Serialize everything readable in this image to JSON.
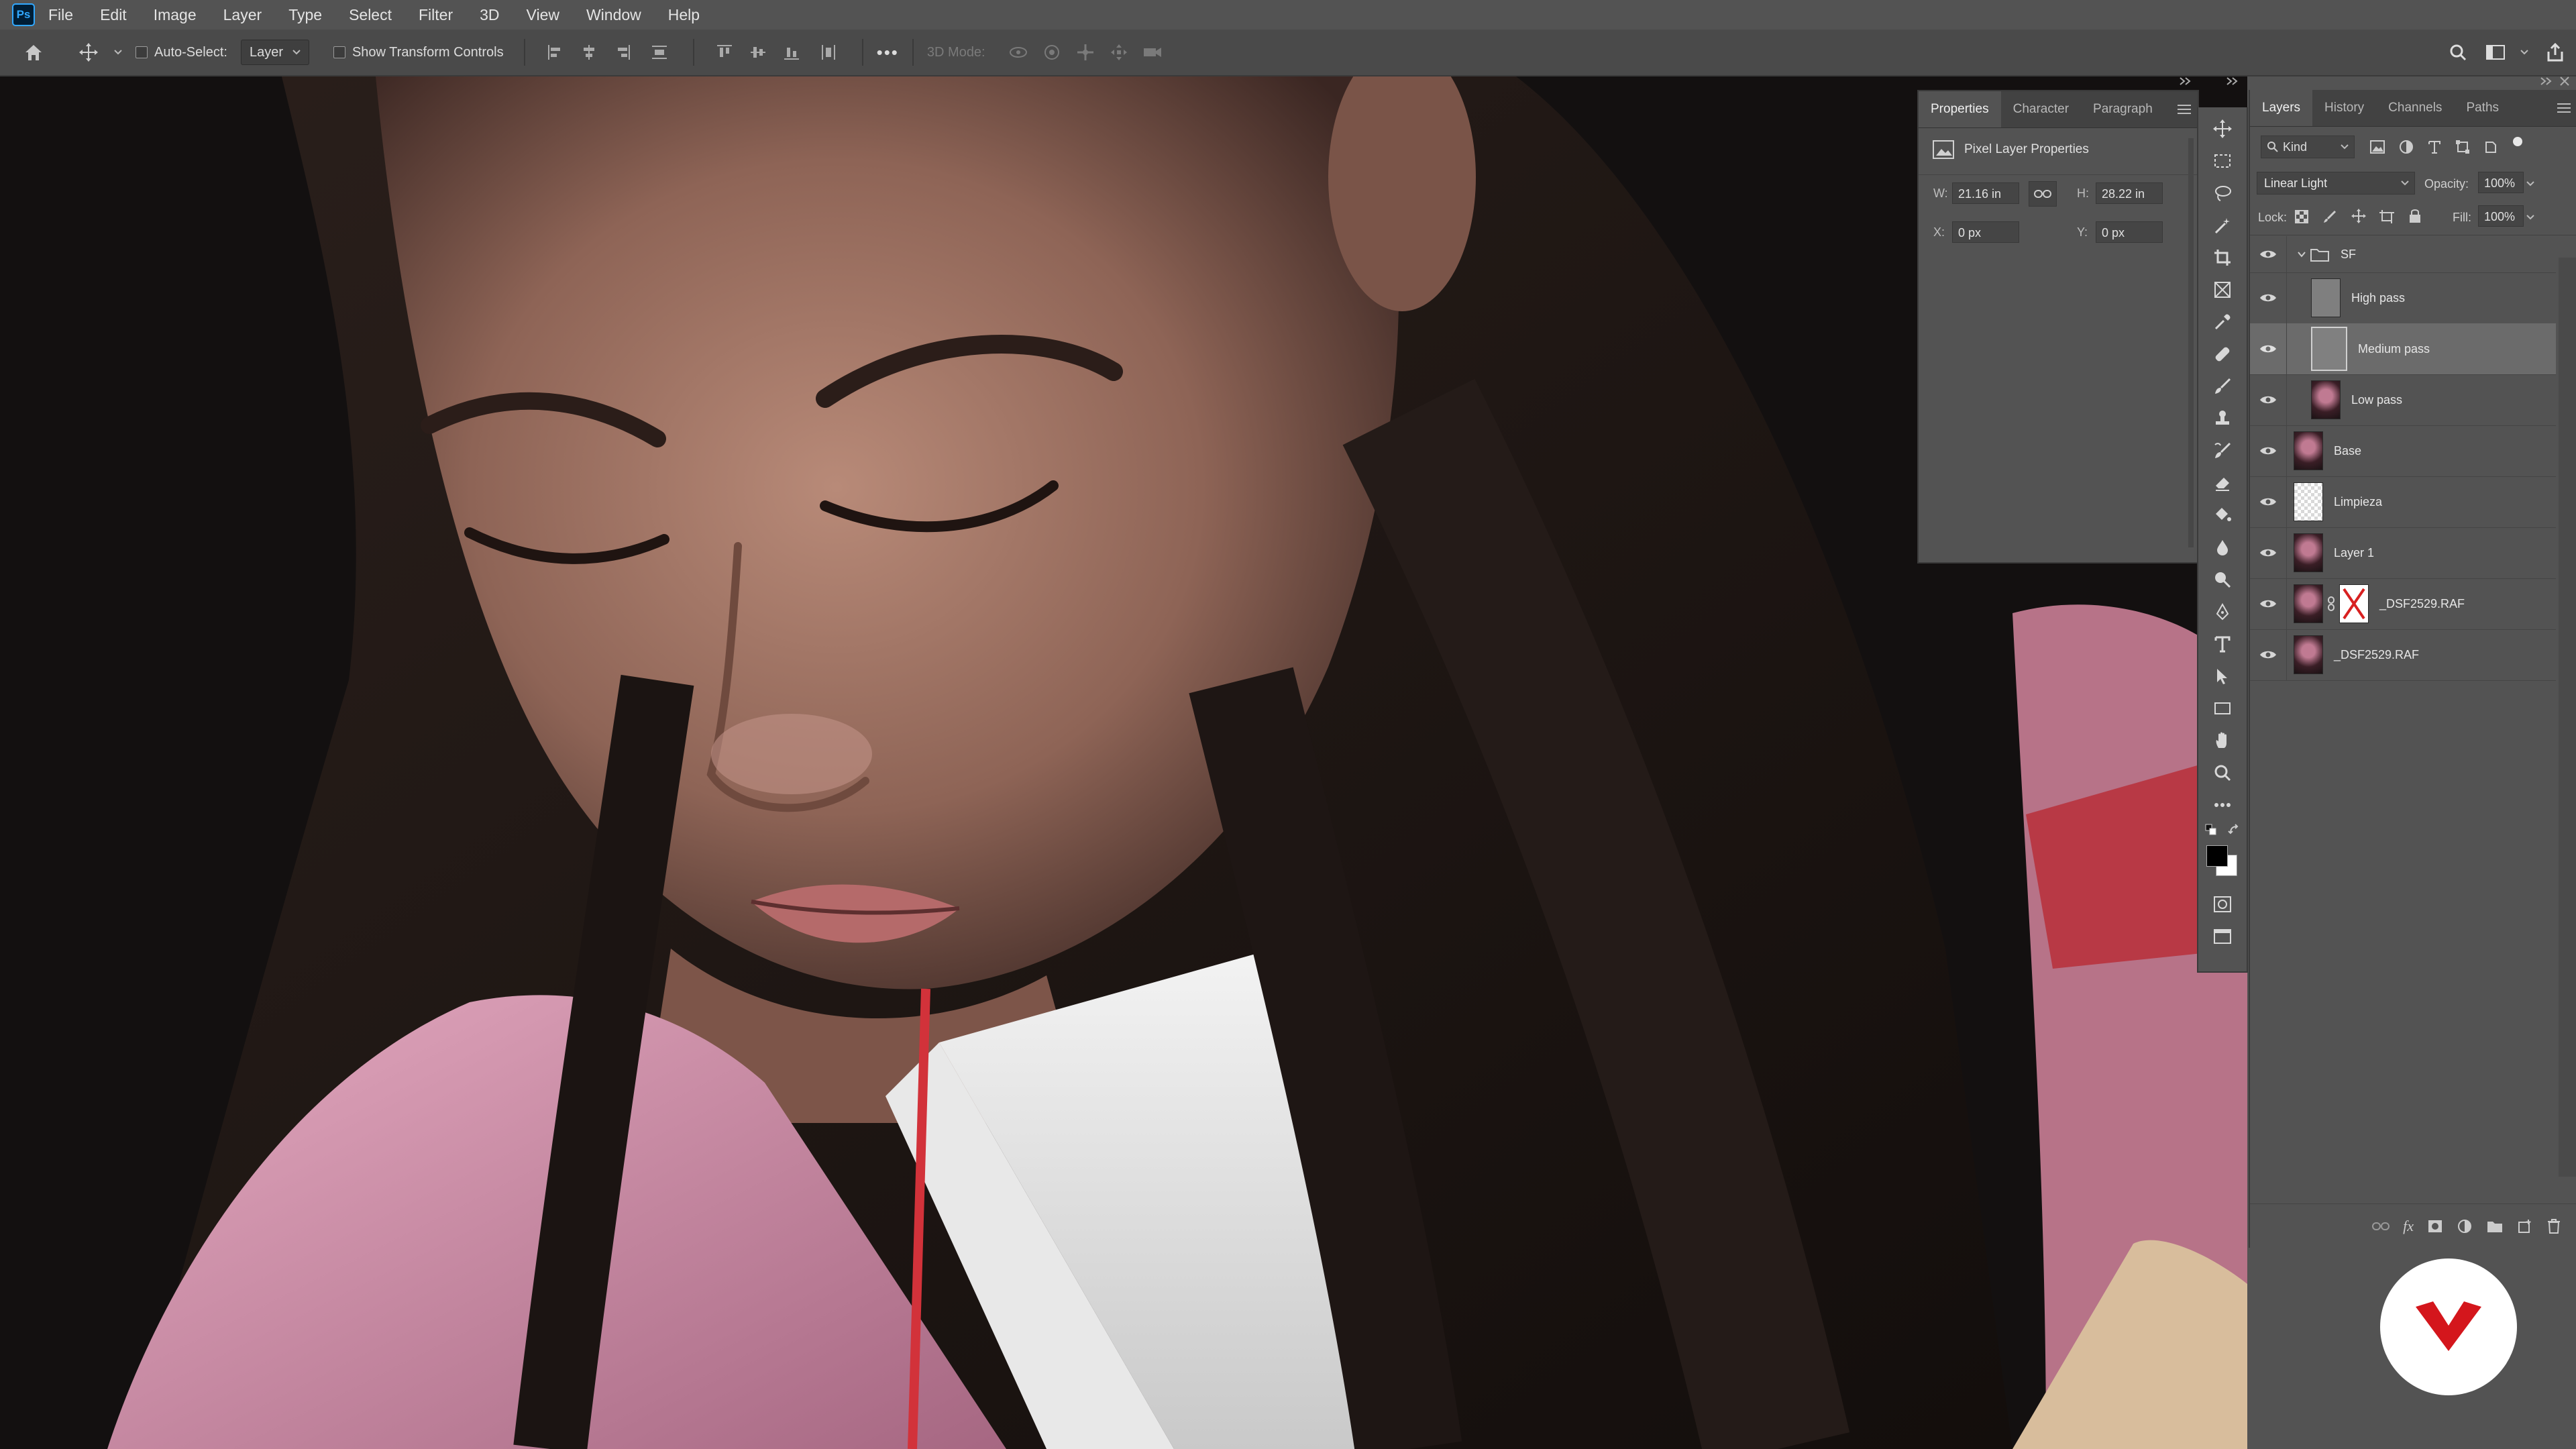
{
  "app": {
    "logo_text": "Ps"
  },
  "menubar": {
    "items": [
      "File",
      "Edit",
      "Image",
      "Layer",
      "Type",
      "Select",
      "Filter",
      "3D",
      "View",
      "Window",
      "Help"
    ]
  },
  "optionsbar": {
    "auto_select_label": "Auto-Select:",
    "auto_select_target": "Layer",
    "show_transform_label": "Show Transform Controls",
    "more_label": "•••",
    "mode_3d_label": "3D Mode:"
  },
  "properties": {
    "tabs": [
      "Properties",
      "Character",
      "Paragraph"
    ],
    "section_title": "Pixel Layer Properties",
    "w_label": "W:",
    "w_value": "21.16 in",
    "h_label": "H:",
    "h_value": "28.22 in",
    "x_label": "X:",
    "x_value": "0 px",
    "y_label": "Y:",
    "y_value": "0 px"
  },
  "layers_panel": {
    "tabs": [
      "Layers",
      "History",
      "Channels",
      "Paths"
    ],
    "filter_label": "Kind",
    "blend_mode": "Linear Light",
    "opacity_label": "Opacity:",
    "opacity_value": "100%",
    "lock_label": "Lock:",
    "fill_label": "Fill:",
    "fill_value": "100%",
    "layers": [
      {
        "name": "SF",
        "type": "group"
      },
      {
        "name": "High pass",
        "type": "gray"
      },
      {
        "name": "Medium pass",
        "type": "gray",
        "selected": true
      },
      {
        "name": "Low pass",
        "type": "photo"
      },
      {
        "name": "Base",
        "type": "photo"
      },
      {
        "name": "Limpieza",
        "type": "transparent"
      },
      {
        "name": "Layer 1",
        "type": "photo"
      },
      {
        "name": "_DSF2529.RAF",
        "type": "photo-mask"
      },
      {
        "name": "_DSF2529.RAF",
        "type": "photo"
      }
    ]
  },
  "colors": {
    "ps_blue": "#31a8ff",
    "panel_bg": "#535353",
    "selected_row": "#6b6b6b",
    "watermark_red": "#d4161c"
  }
}
